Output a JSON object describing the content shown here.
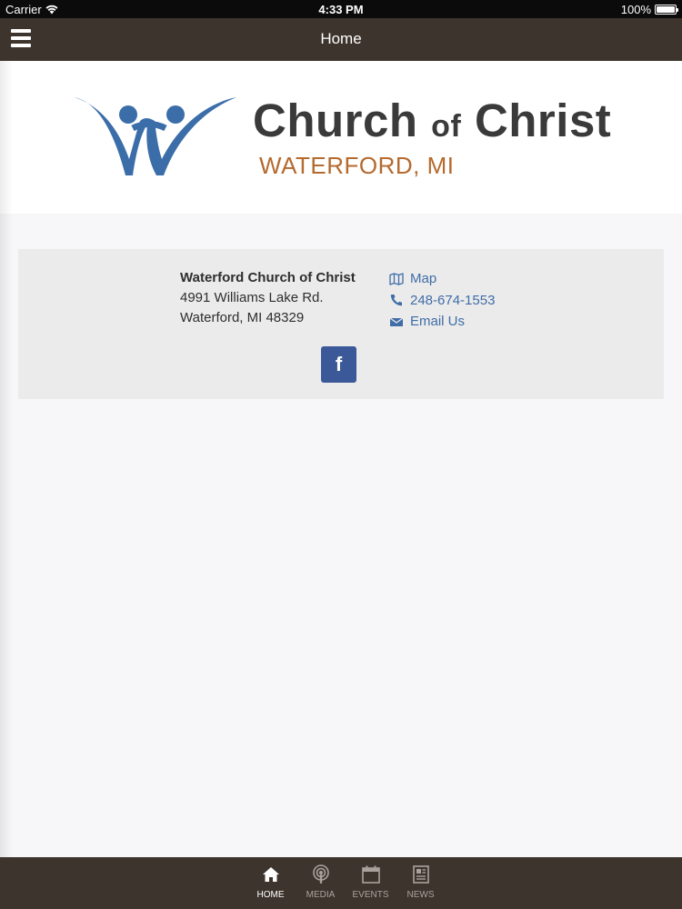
{
  "status_bar": {
    "carrier": "Carrier",
    "time": "4:33 PM",
    "battery": "100%",
    "battery_level": 1.0
  },
  "nav": {
    "title": "Home",
    "menu_icon": "hamburger-menu-icon"
  },
  "logo": {
    "title_part1": "Church",
    "title_of": "of",
    "title_part2": "Christ",
    "subtitle": "WATERFORD, MI",
    "colors": {
      "mark": "#3b6ea9",
      "title": "#3a3a3a",
      "subtitle": "#b56a2e"
    }
  },
  "contact": {
    "name": "Waterford Church of Christ",
    "street": "4991 Williams Lake Rd.",
    "city": "Waterford, MI 48329",
    "links": [
      {
        "label": "Map",
        "icon": "map-icon"
      },
      {
        "label": "248-674-1553",
        "icon": "phone-icon"
      },
      {
        "label": "Email Us",
        "icon": "envelope-icon"
      }
    ],
    "facebook_glyph": "f",
    "colors": {
      "link": "#3f6ea7",
      "facebook": "#3b5998"
    }
  },
  "tabs": [
    {
      "label": "HOME",
      "icon": "home-icon",
      "active": true
    },
    {
      "label": "MEDIA",
      "icon": "podcast-icon",
      "active": false
    },
    {
      "label": "EVENTS",
      "icon": "calendar-icon",
      "active": false
    },
    {
      "label": "NEWS",
      "icon": "newspaper-icon",
      "active": false
    }
  ],
  "colors": {
    "bar": "#3d342d",
    "background": "#f7f7f9",
    "card": "#ebebeb"
  }
}
